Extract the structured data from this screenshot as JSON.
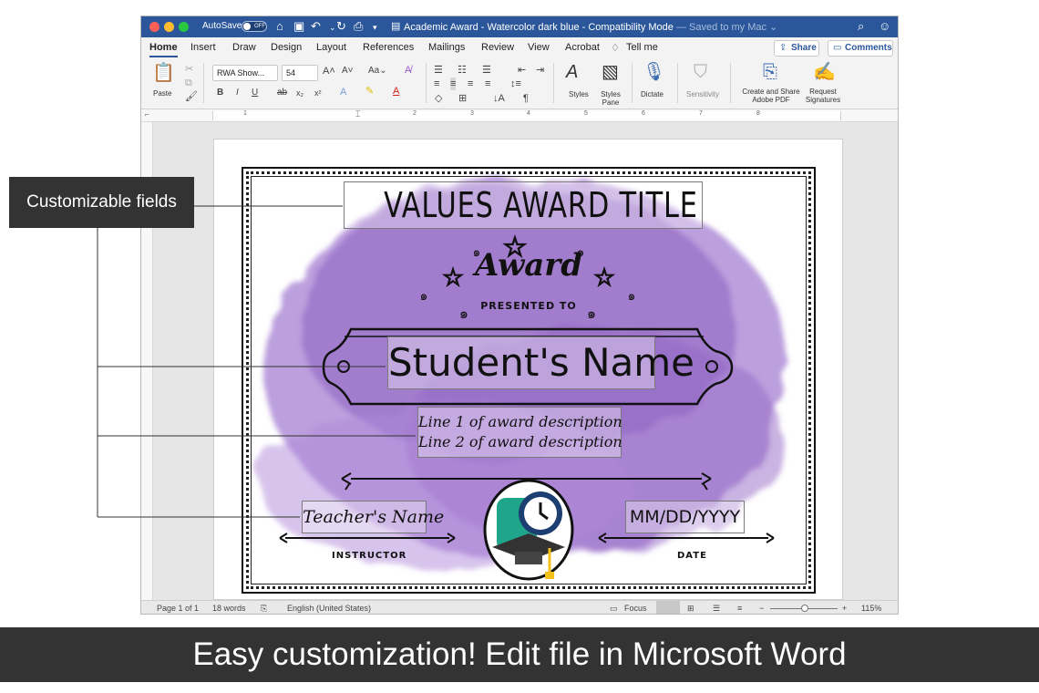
{
  "window": {
    "autosave_label": "AutoSave",
    "autosave_state": "OFF",
    "title": "Academic Award - Watercolor dark blue  -  Compatibility Mode",
    "save_status": "— Saved to my Mac ⌄"
  },
  "tabs": [
    {
      "label": "Home",
      "active": true
    },
    {
      "label": "Insert"
    },
    {
      "label": "Draw"
    },
    {
      "label": "Design"
    },
    {
      "label": "Layout"
    },
    {
      "label": "References"
    },
    {
      "label": "Mailings"
    },
    {
      "label": "Review"
    },
    {
      "label": "View"
    },
    {
      "label": "Acrobat"
    },
    {
      "label": "Tell me"
    }
  ],
  "share_label": "Share",
  "comments_label": "Comments",
  "ribbon": {
    "paste_label": "Paste",
    "font_name": "RWA Show...",
    "font_size": "54",
    "styles_label": "Styles",
    "styles_pane_label": "Styles Pane",
    "dictate_label": "Dictate",
    "sensitivity_label": "Sensitivity",
    "create_share_label": "Create and Share Adobe PDF",
    "request_signatures_label": "Request Signatures"
  },
  "ruler_numbers": [
    "1",
    "1",
    "2",
    "3",
    "4",
    "5",
    "6",
    "7",
    "8"
  ],
  "status": {
    "page": "Page 1 of 1",
    "words": "18 words",
    "language": "English (United States)",
    "focus": "Focus",
    "zoom": "115%"
  },
  "certificate": {
    "title": "VALUES AWARD TITLE",
    "award": "Award",
    "presented_to": "PRESENTED TO",
    "student_name": "Student's Name",
    "desc_line1": "Line 1 of award description",
    "desc_line2": "Line 2 of award description",
    "teacher_name": "Teacher's Name",
    "instructor_label": "INSTRUCTOR",
    "date_value": "MM/DD/YYYY",
    "date_label": "DATE"
  },
  "callout_label": "Customizable fields",
  "banner_text": "Easy customization! Edit file in Microsoft Word",
  "colors": {
    "word_blue": "#2b579a",
    "watercolor_purple": "#9a6cc8",
    "callout_gray": "#333333"
  }
}
